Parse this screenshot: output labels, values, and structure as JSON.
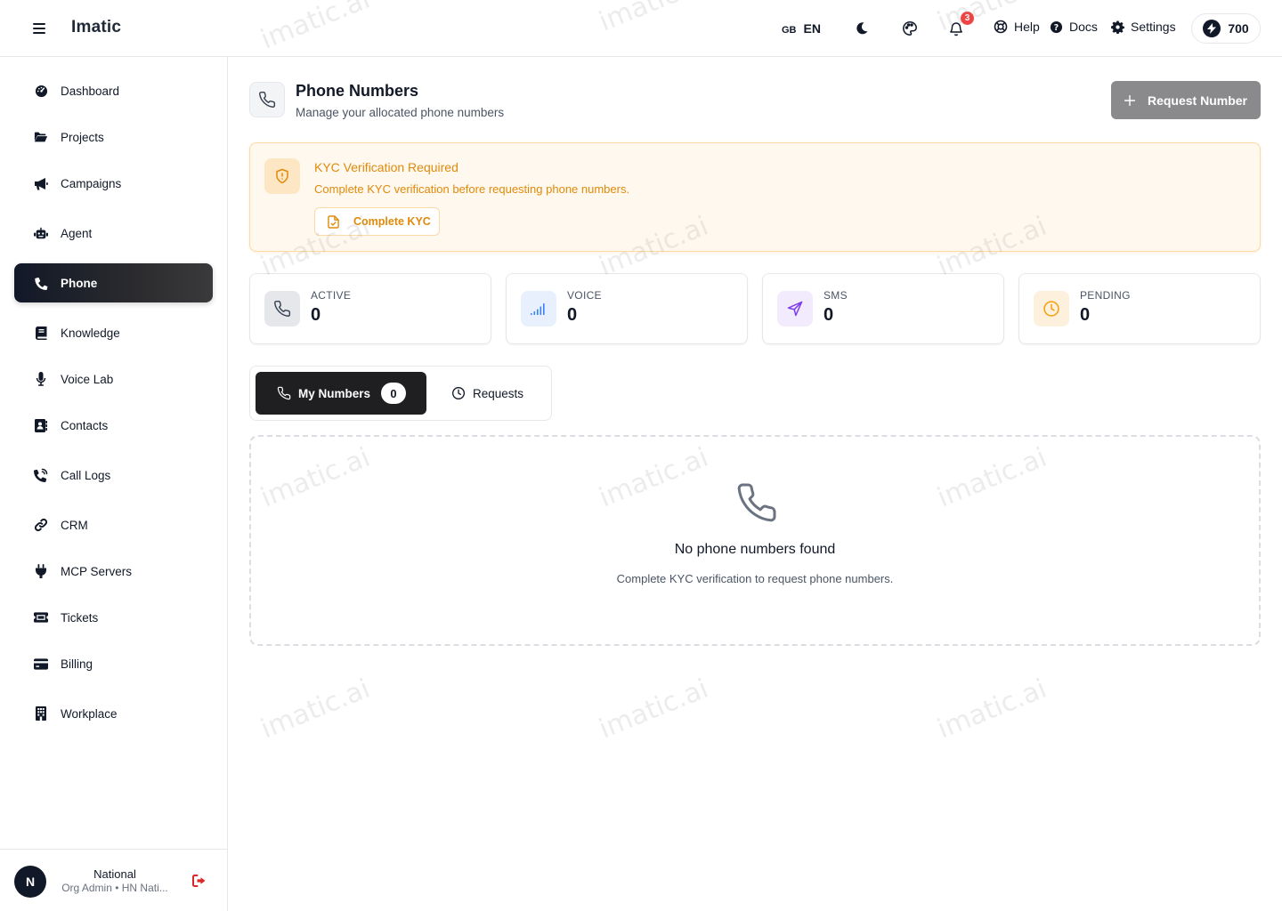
{
  "app": {
    "brand": "Imatic"
  },
  "topbar": {
    "lang_flag": "GB",
    "lang_code": "EN",
    "notifications_count": "3",
    "help_label": "Help",
    "docs_label": "Docs",
    "settings_label": "Settings",
    "credits": "700"
  },
  "sidebar": {
    "items": [
      {
        "label": "Dashboard",
        "icon": "gauge-icon"
      },
      {
        "label": "Projects",
        "icon": "folder-open-icon"
      },
      {
        "label": "Campaigns",
        "icon": "megaphone-icon"
      },
      {
        "label": "Agent",
        "icon": "robot-icon"
      },
      {
        "label": "Phone",
        "icon": "phone-icon",
        "active": true
      },
      {
        "label": "Knowledge",
        "icon": "book-icon"
      },
      {
        "label": "Voice Lab",
        "icon": "microphone-icon"
      },
      {
        "label": "Contacts",
        "icon": "address-book-icon"
      },
      {
        "label": "Call Logs",
        "icon": "phone-volume-icon"
      },
      {
        "label": "CRM",
        "icon": "link-icon"
      },
      {
        "label": "MCP Servers",
        "icon": "plug-icon"
      },
      {
        "label": "Tickets",
        "icon": "ticket-icon"
      },
      {
        "label": "Billing",
        "icon": "credit-card-icon"
      },
      {
        "label": "Workplace",
        "icon": "building-icon"
      }
    ],
    "user": {
      "initial": "N",
      "name": "National",
      "role": "Org Admin • HN Nati..."
    }
  },
  "page": {
    "title": "Phone Numbers",
    "subtitle": "Manage your allocated phone numbers",
    "request_button": "Request Number"
  },
  "kyc": {
    "title": "KYC Verification Required",
    "text": "Complete KYC verification before requesting phone numbers.",
    "button": "Complete KYC"
  },
  "stats": [
    {
      "label": "ACTIVE",
      "value": "0"
    },
    {
      "label": "VOICE",
      "value": "0"
    },
    {
      "label": "SMS",
      "value": "0"
    },
    {
      "label": "PENDING",
      "value": "0"
    }
  ],
  "tabs": {
    "my_numbers": "My Numbers",
    "my_numbers_count": "0",
    "requests": "Requests"
  },
  "empty": {
    "title": "No phone numbers found",
    "text": "Complete KYC verification to request phone numbers."
  },
  "watermark": "imatic.ai",
  "colors": {
    "accent_dark": "#111827",
    "warning": "#e08a0b",
    "voice": "#3b82f6",
    "sms": "#7c3aed",
    "pending": "#f59e0b"
  }
}
